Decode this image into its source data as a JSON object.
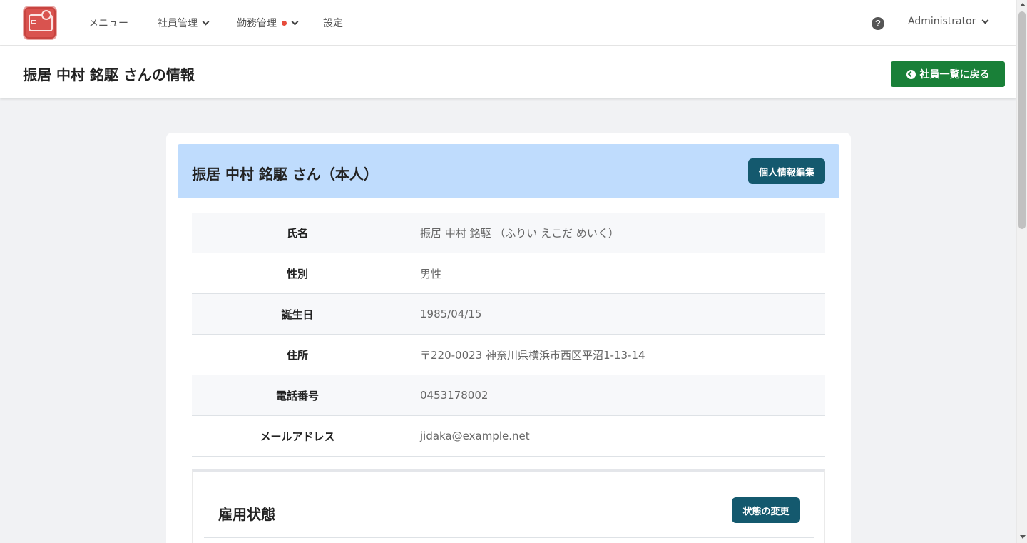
{
  "nav": {
    "items": [
      {
        "label": "メニュー"
      },
      {
        "label": "社員管理"
      },
      {
        "label": "勤務管理"
      },
      {
        "label": "設定"
      }
    ],
    "help_icon": "question-circle-icon",
    "user": "Administrator"
  },
  "page": {
    "title": "振居 中村 銘駆 さんの情報",
    "back_label": "社員一覧に戻る"
  },
  "profile": {
    "heading": "振居 中村 銘駆 さん（本人）",
    "edit_label": "個人情報編集",
    "rows": [
      {
        "label": "氏名",
        "value": "振居 中村 銘駆 （ふりい えこだ めいく）"
      },
      {
        "label": "性別",
        "value": "男性"
      },
      {
        "label": "誕生日",
        "value": "1985/04/15"
      },
      {
        "label": "住所",
        "value": "〒220-0023 神奈川県横浜市西区平沼1-13-14"
      },
      {
        "label": "電話番号",
        "value": "0453178002"
      },
      {
        "label": "メールアドレス",
        "value": "jidaka@example.net"
      }
    ]
  },
  "employment": {
    "title": "雇用状態",
    "change_label": "状態の変更"
  },
  "colors": {
    "back_button": "#198038",
    "header_band": "#bfdcfd",
    "action_button": "#14596e",
    "logo": "#d9534f"
  }
}
